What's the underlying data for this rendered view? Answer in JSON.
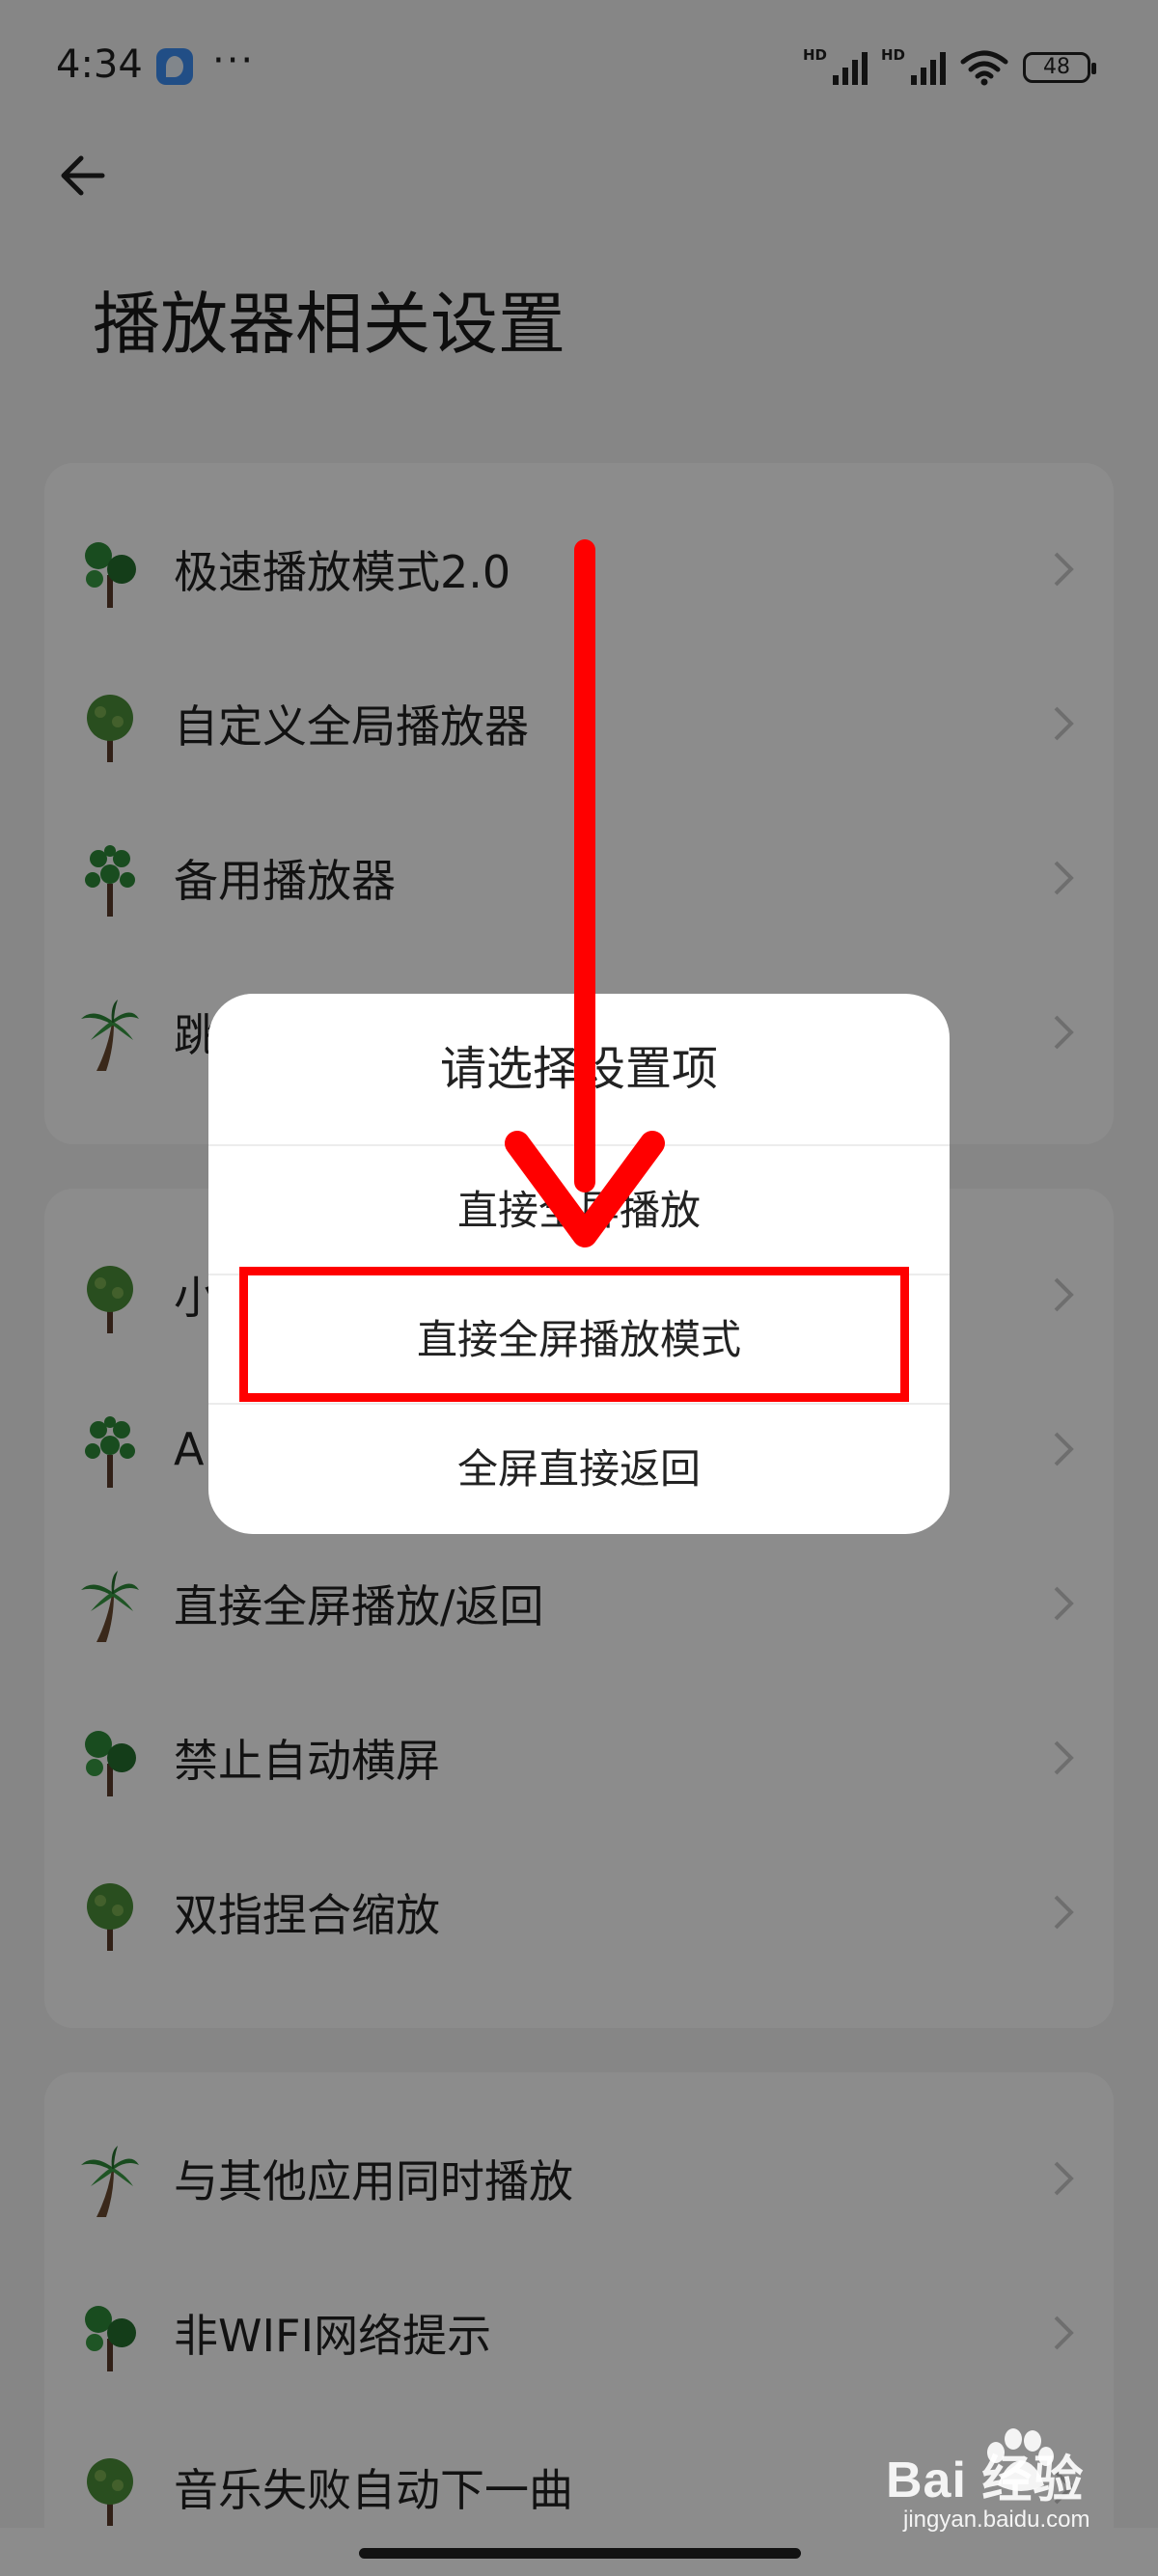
{
  "status_bar": {
    "time": "4:34",
    "more": "···",
    "hd1": "HD",
    "hd2": "HD",
    "battery": "48"
  },
  "header": {
    "title": "播放器相关设置"
  },
  "sections": [
    {
      "items": [
        {
          "label": "极速播放模式2.0",
          "icon": "tree-broadleaf-icon"
        },
        {
          "label": "自定义全局播放器",
          "icon": "tree-oak-icon"
        },
        {
          "label": "备用播放器",
          "icon": "tree-cluster-icon"
        },
        {
          "label": "跳",
          "icon": "palm-tree-icon"
        }
      ]
    },
    {
      "items": [
        {
          "label": "小",
          "icon": "tree-oak-icon"
        },
        {
          "label": "AI",
          "icon": "tree-cluster-icon"
        },
        {
          "label": "直接全屏播放/返回",
          "icon": "palm-tree-icon"
        },
        {
          "label": "禁止自动横屏",
          "icon": "tree-broadleaf-icon"
        },
        {
          "label": "双指捏合缩放",
          "icon": "tree-oak-icon"
        }
      ]
    },
    {
      "items": [
        {
          "label": "与其他应用同时播放",
          "icon": "palm-tree-icon"
        },
        {
          "label": "非WIFI网络提示",
          "icon": "tree-broadleaf-icon"
        },
        {
          "label": "音乐失败自动下一曲",
          "icon": "tree-oak-icon"
        }
      ]
    }
  ],
  "dialog": {
    "title": "请选择设置项",
    "options": [
      "直接全屏播放",
      "直接全屏播放模式",
      "全屏直接返回"
    ],
    "highlighted_option": "直接全屏播放模式"
  },
  "watermark": {
    "text": "Bai 经验",
    "sub": "jingyan.baidu.com"
  },
  "colors": {
    "annotation": "#ff0000",
    "tree_green": "#2f8a3a",
    "trunk": "#5a3b2a",
    "background": "#f4f4f4",
    "card": "#ffffff"
  }
}
